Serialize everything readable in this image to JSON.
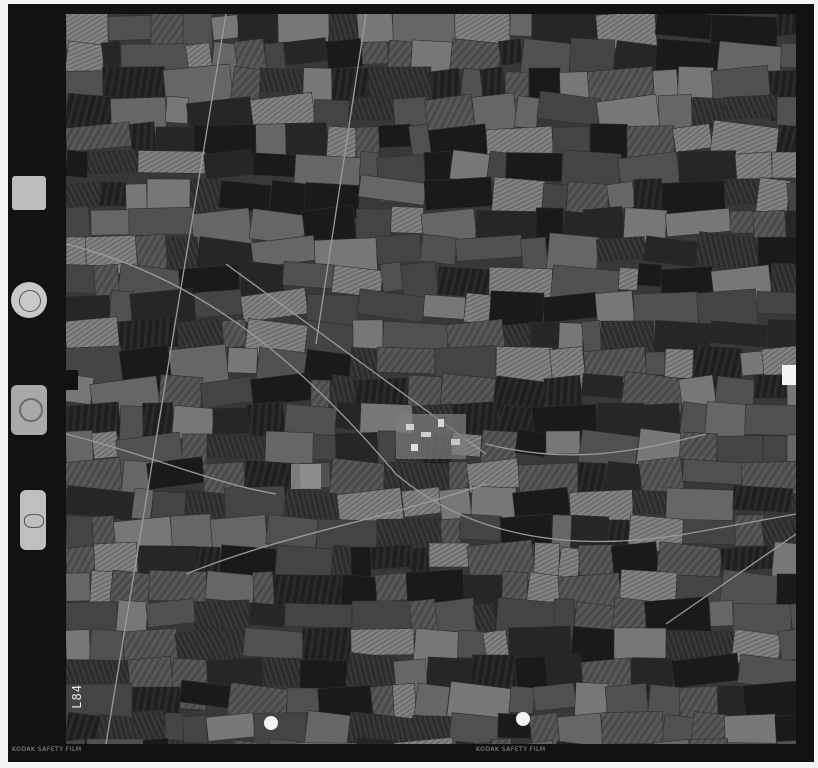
{
  "frame_number": "L84",
  "film_label_left": "KODAK SAFETY FILM",
  "film_label_bottom": "KODAK SAFETY FILM",
  "photo": {
    "subject": "aerial photograph",
    "icon": "aerial-farmland-photo"
  },
  "instruments": [
    {
      "name": "clock-icon"
    },
    {
      "name": "compass-icon"
    },
    {
      "name": "altimeter-icon"
    },
    {
      "name": "level-bubble-icon"
    }
  ]
}
